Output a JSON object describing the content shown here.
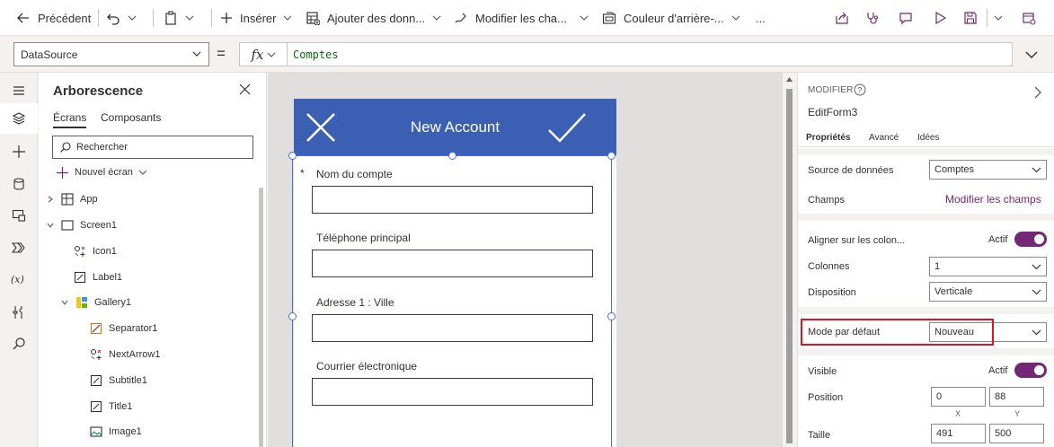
{
  "toolbar": {
    "back_label": "Précédent",
    "insert_label": "Insérer",
    "add_data_label": "Ajouter des donn...",
    "edit_fields_label": "Modifier les cha...",
    "background_color_label": "Couleur d'arrière-...",
    "more_label": "..."
  },
  "formula_bar": {
    "property": "DataSource",
    "equals": "=",
    "fx_label": "fx",
    "formula": "Comptes"
  },
  "tree_view": {
    "title": "Arborescence",
    "tabs": [
      "Écrans",
      "Composants"
    ],
    "search_placeholder": "Rechercher",
    "new_screen_label": "Nouvel écran",
    "nodes": [
      {
        "label": "App",
        "icon": "app-icon",
        "expanded": false
      },
      {
        "label": "Screen1",
        "icon": "screen-icon",
        "expanded": true
      },
      {
        "label": "Icon1",
        "icon": "icon-control-icon"
      },
      {
        "label": "Label1",
        "icon": "label-control-icon"
      },
      {
        "label": "Gallery1",
        "icon": "gallery-icon",
        "expanded": true
      },
      {
        "label": "Separator1",
        "icon": "separator-icon"
      },
      {
        "label": "NextArrow1",
        "icon": "icon-control-icon"
      },
      {
        "label": "Subtitle1",
        "icon": "label-control-icon"
      },
      {
        "label": "Title1",
        "icon": "label-control-icon"
      },
      {
        "label": "Image1",
        "icon": "image-icon"
      }
    ]
  },
  "canvas": {
    "header_title": "New Account",
    "header_color": "#3a5fb3",
    "fields": [
      {
        "label": "Nom du compte",
        "required": true,
        "required_mark": "*"
      },
      {
        "label": "Téléphone principal",
        "required": false
      },
      {
        "label": "Adresse 1 : Ville",
        "required": false
      },
      {
        "label": "Courrier électronique",
        "required": false
      }
    ]
  },
  "properties": {
    "section_label": "MODIFIER",
    "control_name": "EditForm3",
    "tabs": [
      "Propriétés",
      "Avancé",
      "Idées"
    ],
    "data_source_label": "Source de données",
    "data_source_value": "Comptes",
    "fields_label": "Champs",
    "edit_fields_link": "Modifier les champs",
    "snap_columns_label": "Aligner sur les colon...",
    "snap_columns_state": "Actif",
    "columns_label": "Colonnes",
    "columns_value": "1",
    "layout_label": "Disposition",
    "layout_value": "Verticale",
    "default_mode_label": "Mode par défaut",
    "default_mode_value": "Nouveau",
    "visible_label": "Visible",
    "visible_state": "Actif",
    "position_label": "Position",
    "position_x": "0",
    "position_y": "88",
    "x_label": "X",
    "y_label": "Y",
    "size_label": "Taille",
    "size_width": "491",
    "size_height": "500",
    "accent_color": "#742774",
    "highlight_color": "#e81123"
  }
}
